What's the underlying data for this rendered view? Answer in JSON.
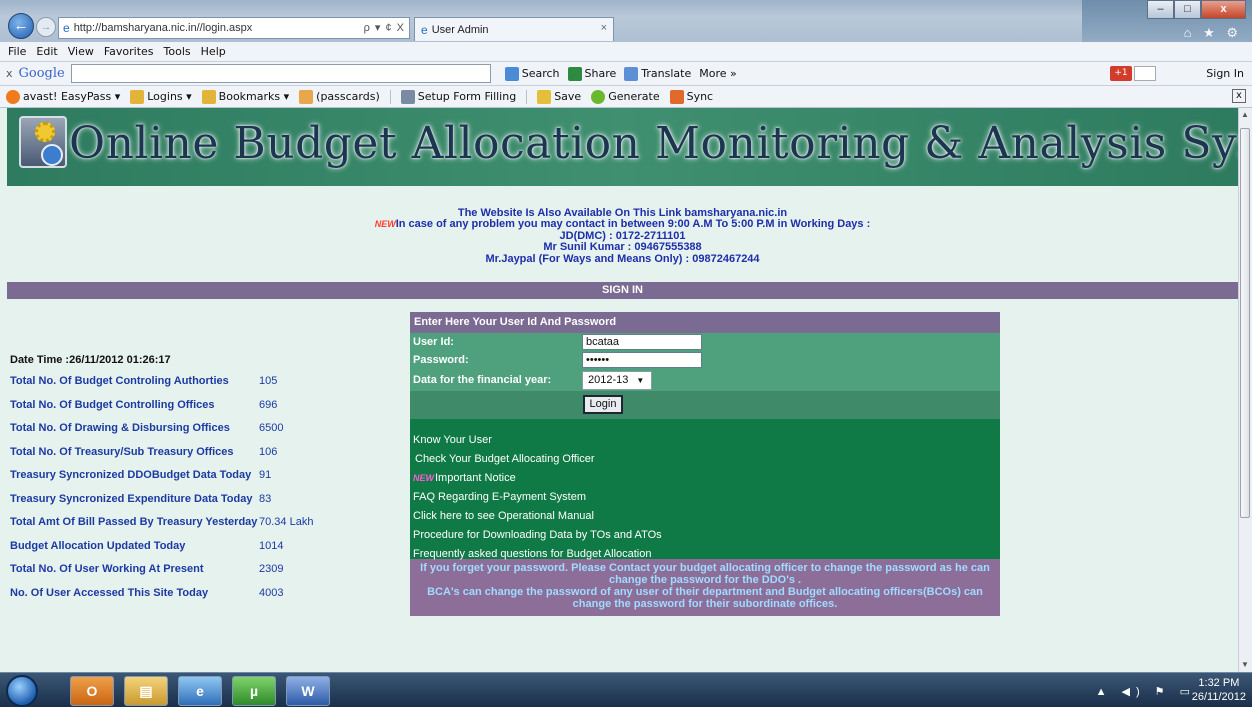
{
  "browser": {
    "url": "http://bamsharyana.nic.in//login.aspx",
    "tab_title": "User Admin",
    "tab_close": "×",
    "back_glyph": "←",
    "forward_glyph": "→",
    "addr_tools": "ρ ▾ ¢ X",
    "right_icons": "⌂ ★ ⚙",
    "window_buttons": [
      "–",
      "□",
      "x"
    ]
  },
  "menubar": [
    "File",
    "Edit",
    "View",
    "Favorites",
    "Tools",
    "Help"
  ],
  "googlebar": {
    "close": "x",
    "logo": "Google",
    "search": "Search",
    "share": "Share",
    "translate": "Translate",
    "more": "More »",
    "gplus": "+1",
    "signin": "Sign In"
  },
  "favorites": {
    "items": [
      "avast! EasyPass ▾",
      "Logins ▾",
      "Bookmarks ▾",
      "(passcards)",
      "Setup Form Filling",
      "Save",
      "Generate",
      "Sync"
    ],
    "close": "x"
  },
  "banner": {
    "title": "Online Budget Allocation Monitoring & Analysis System"
  },
  "info": {
    "line1": "The Website Is Also Available On This Link bamsharyana.nic.in",
    "new_badge": "NEW",
    "line2": "In case of any problem you may contact in between 9:00 A.M To 5:00 P.M in Working Days :",
    "line3": "JD(DMC) : 0172-2711101",
    "line4": "Mr Sunil Kumar : 09467555388",
    "line5": "Mr.Jaypal (For Ways and Means Only) : 09872467244"
  },
  "signin_bar": "SIGN IN",
  "stats": {
    "datetime": "Date Time :26/11/2012 01:26:17",
    "rows": [
      {
        "label": "Total No. Of Budget Controling Authorties",
        "value": "105"
      },
      {
        "label": "Total No. Of Budget Controlling Offices",
        "value": "696"
      },
      {
        "label": "Total No. Of Drawing & Disbursing Offices",
        "value": "6500"
      },
      {
        "label": "Total No. Of Treasury/Sub Treasury Offices",
        "value": "106"
      },
      {
        "label": "Treasury Syncronized DDOBudget Data Today",
        "value": "91"
      },
      {
        "label": "Treasury Syncronized Expenditure Data Today",
        "value": "83"
      },
      {
        "label": "Total Amt Of Bill Passed By Treasury Yesterday",
        "value": "70.34 Lakh"
      },
      {
        "label": "Budget Allocation Updated Today",
        "value": "1014"
      },
      {
        "label": "Total No. Of User Working At Present",
        "value": "2309"
      },
      {
        "label": "No. Of User Accessed This Site Today",
        "value": "4003"
      }
    ]
  },
  "login": {
    "header": "Enter Here Your User Id And Password",
    "userid_label": "User Id:",
    "userid_value": "bcataa",
    "password_label": "Password:",
    "password_value": "••••••",
    "fy_label": "Data for the financial year:",
    "fy_value": "2012-13",
    "login_button": "Login"
  },
  "links": [
    {
      "text": "Know Your User",
      "new": false
    },
    {
      "text": "Check Your Budget Allocating Officer",
      "new": false
    },
    {
      "text": "Important Notice",
      "new": true
    },
    {
      "text": "FAQ Regarding E-Payment System",
      "new": false
    },
    {
      "text": "Click here to see Operational Manual",
      "new": false
    },
    {
      "text": "Procedure for Downloading Data by TOs and ATOs",
      "new": false
    },
    {
      "text": "Frequently asked questions for Budget Allocation",
      "new": false
    }
  ],
  "footnote": {
    "line1": "If you forget your password. Please Contact your budget allocating officer to change the password as he can",
    "line2": "change the password for the DDO's .",
    "line3": "BCA's can change the password of any user of their department and Budget allocating officers(BCOs) can",
    "line4": "change the password for their subordinate offices."
  },
  "taskbar": {
    "time": "1:32 PM",
    "date": "26/11/2012",
    "tray": "▲ ◀) ⚑ ▭"
  },
  "colors": {
    "banner_green": "#3f8f70",
    "purple_bar": "#7b6a91",
    "link_green": "#0f7a45",
    "stat_blue": "#1d3aa3"
  }
}
